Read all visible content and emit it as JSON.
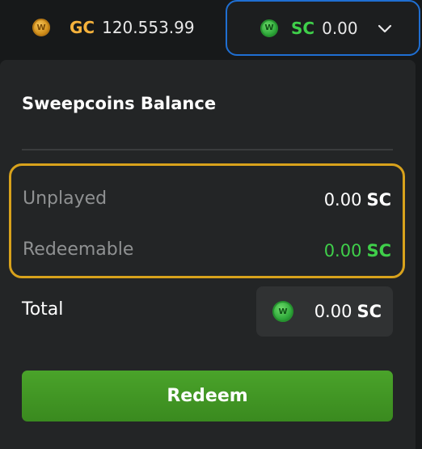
{
  "wallets": {
    "gc": {
      "icon": "gold-coin-icon",
      "label": "GC",
      "value": "120.553.99",
      "color": "#f5b23c"
    },
    "sc": {
      "icon": "sweepcoin-icon",
      "label": "SC",
      "value": "0.00",
      "color": "#3fcf4a",
      "dropdown_icon": "chevron-down-icon"
    }
  },
  "panel": {
    "title": "Sweepcoins Balance",
    "rows": [
      {
        "label": "Unplayed",
        "value": "0.00",
        "unit": "SC"
      },
      {
        "label": "Redeemable",
        "value": "0.00",
        "unit": "SC"
      }
    ],
    "total": {
      "label": "Total",
      "icon": "sweepcoin-icon",
      "value": "0.00",
      "unit": "SC"
    },
    "redeem_button": "Redeem"
  },
  "colors": {
    "accent_border": "#d8a21c",
    "selected_wallet_border": "#1f6fd2",
    "button": "#44a126",
    "panel_bg": "#232526"
  }
}
